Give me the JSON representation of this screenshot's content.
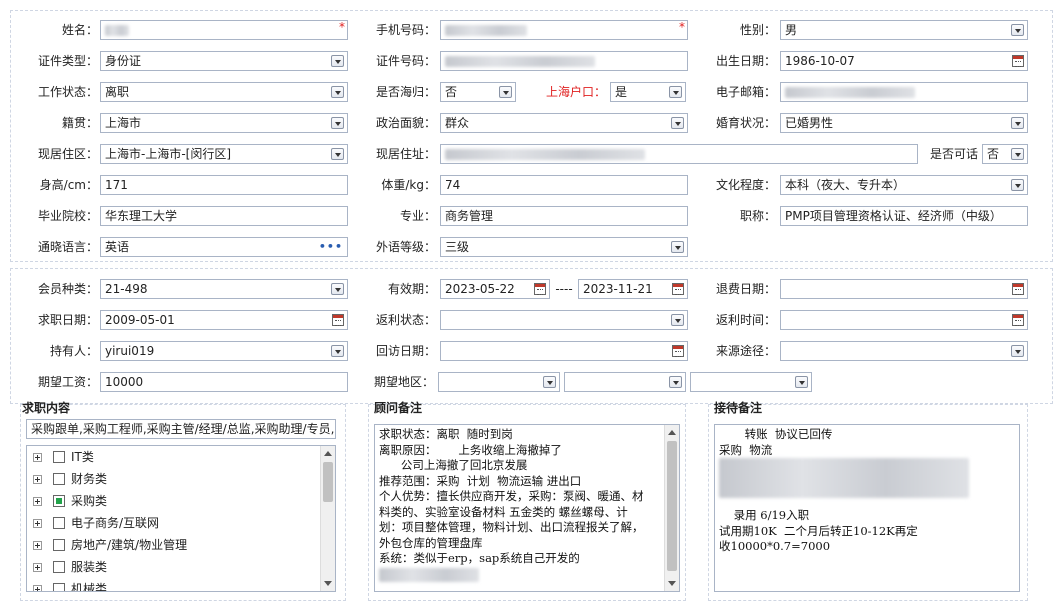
{
  "personal": {
    "name_label": "姓名：",
    "phone_label": "手机号码：",
    "gender_label": "性别：",
    "gender_value": "男",
    "id_type_label": "证件类型：",
    "id_type_value": "身份证",
    "id_no_label": "证件号码：",
    "birth_label": "出生日期：",
    "birth_value": "1986-10-07",
    "work_status_label": "工作状态：",
    "work_status_value": "离职",
    "returnee_label": "是否海归：",
    "returnee_value": "否",
    "sh_hukou_label": "上海户口：",
    "sh_hukou_value": "是",
    "email_label": "电子邮箱：",
    "native_label": "籍贯：",
    "native_value": "上海市",
    "political_label": "政治面貌：",
    "political_value": "群众",
    "marital_label": "婚育状况：",
    "marital_value": "已婚男性",
    "residence_area_label": "现居住区：",
    "residence_area_value": "上海市-上海市-[闵行区]",
    "address_label": "现居住址：",
    "visitable_label": "是否可话",
    "visitable_value": "否",
    "height_label": "身高/cm：",
    "height_value": "171",
    "weight_label": "体重/kg：",
    "weight_value": "74",
    "education_label": "文化程度：",
    "education_value": "本科（夜大、专升本）",
    "school_label": "毕业院校：",
    "school_value": "华东理工大学",
    "major_label": "专业：",
    "major_value": "商务管理",
    "title_label": "职称：",
    "title_value": "PMP项目管理资格认证、经济师（中级）",
    "language_label": "通晓语言：",
    "language_value": "英语",
    "lang_level_label": "外语等级：",
    "lang_level_value": "三级"
  },
  "membership": {
    "member_type_label": "会员种类：",
    "member_type_value": "21-498",
    "validity_label": "有效期：",
    "validity_from": "2023-05-22",
    "validity_sep": "----",
    "validity_to": "2023-11-21",
    "refund_date_label": "退费日期：",
    "job_date_label": "求职日期：",
    "job_date_value": "2009-05-01",
    "rebate_status_label": "返利状态：",
    "rebate_time_label": "返利时间：",
    "holder_label": "持有人：",
    "holder_value": "yirui019",
    "visit_date_label": "回访日期：",
    "source_label": "来源途径：",
    "salary_label": "期望工资：",
    "salary_value": "10000",
    "region_label": "期望地区："
  },
  "job_intent": {
    "title": "求职内容",
    "summary": "采购跟单,采购工程师,采购主管/经理/总监,采购助理/专员,(",
    "tree": [
      {
        "label": "IT类",
        "checked": false
      },
      {
        "label": "财务类",
        "checked": false
      },
      {
        "label": "采购类",
        "checked": true
      },
      {
        "label": "电子商务/互联网",
        "checked": false
      },
      {
        "label": "房地产/建筑/物业管理",
        "checked": false
      },
      {
        "label": "服装类",
        "checked": false
      },
      {
        "label": "机械类",
        "checked": false
      }
    ]
  },
  "consultant_notes": {
    "title": "顾问备注",
    "lines": [
      "求职状态：离职  随时到岗",
      "离职原因：      上务收缩上海撤掉了",
      "      公司上海撤了回北京发展",
      "推荐范围：采购  计划  物流运输 进出口",
      "个人优势：擅长供应商开发，采购：泵阀、暖通、材",
      "料类的、实验室设备材料 五金类的 螺丝螺母、计",
      "划：项目整体管理，物料计划、出口流程报关了解，",
      "外包仓库的管理盘库",
      "系统：类似于erp，sap系统自己开发的"
    ]
  },
  "reception_notes": {
    "title": "接待备注",
    "lines": [
      "       转账  协议已回传",
      "采购  物流",
      "",
      "",
      "",
      "",
      "    录用 6/19入职",
      "试用期10K  二个月后转正10-12K再定",
      "收10000*0.7=7000"
    ]
  },
  "icons": {
    "dropdown": "chevron-down-icon",
    "calendar": "calendar-icon",
    "more": "ellipsis-icon",
    "expand": "plus-box-icon"
  },
  "colors": {
    "required": "#e02020",
    "border": "#a9b4c6",
    "checked": "#22a34a"
  }
}
